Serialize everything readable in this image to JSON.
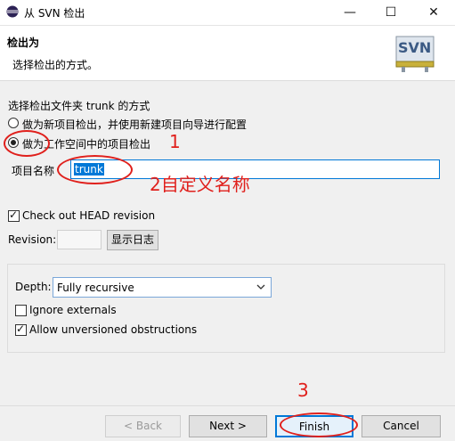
{
  "window": {
    "title": "从 SVN 检出",
    "minimize_glyph": "—",
    "maximize_glyph": "☐",
    "close_glyph": "✕"
  },
  "header": {
    "title": "检出为",
    "description": "选择检出的方式。",
    "logo_text": "SVN"
  },
  "options": {
    "heading": "选择检出文件夹 trunk 的方式",
    "radio_new_project": "做为新项目检出，并使用新建项目向导进行配置",
    "radio_workspace": "做为工作空间中的项目检出",
    "selected": "radio_workspace"
  },
  "project_name": {
    "label": "项目名称",
    "value": "trunk"
  },
  "head_revision": {
    "label": "Check out HEAD revision",
    "checked": true
  },
  "revision": {
    "label": "Revision:",
    "value": "",
    "show_log_button": "显示日志"
  },
  "depth": {
    "label": "Depth:",
    "value": "Fully recursive"
  },
  "ignore_externals": {
    "label": "Ignore externals",
    "checked": false
  },
  "allow_unversioned": {
    "label": "Allow unversioned obstructions",
    "checked": true
  },
  "buttons": {
    "back": "< Back",
    "next": "Next >",
    "finish": "Finish",
    "cancel": "Cancel"
  },
  "annotations": {
    "step1": "1",
    "step2": "2自定义名称",
    "step3": "3",
    "color": "#e0201c"
  },
  "icons": [
    "eclipse-app-icon",
    "svn-logo-icon",
    "chevron-down-icon"
  ]
}
